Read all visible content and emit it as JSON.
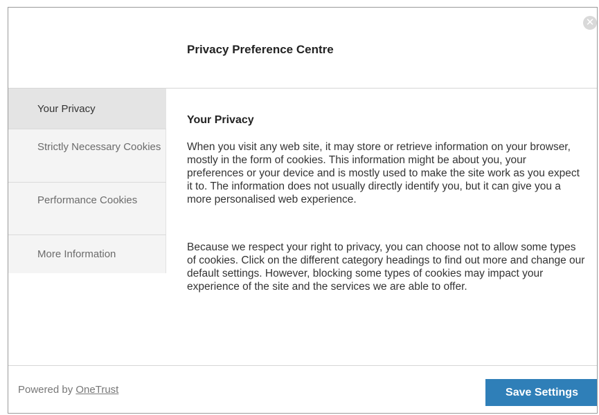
{
  "dialog": {
    "title": "Privacy Preference Centre",
    "close_icon": "close-icon"
  },
  "sidebar": {
    "items": [
      {
        "label": "Your Privacy",
        "active": true
      },
      {
        "label": "Strictly Necessary Cookies",
        "active": false
      },
      {
        "label": "Performance Cookies",
        "active": false
      },
      {
        "label": "More Information",
        "active": false
      }
    ]
  },
  "content": {
    "title": "Your Privacy",
    "paragraphs": [
      "When you visit any web site, it may store or retrieve information on your browser, mostly in the form of cookies. This information might be about you, your preferences or your device and is mostly used to make the site work as you expect it to. The information does not usually directly identify you, but it can give you a more personalised web experience.",
      "Because we respect your right to privacy, you can choose not to allow some types of cookies. Click on the different category headings to find out more and change our default settings. However, blocking some types of cookies may impact your experience of the site and the services we are able to offer."
    ]
  },
  "footer": {
    "powered_prefix": "Powered by ",
    "powered_link": "OneTrust",
    "save_label": "Save Settings"
  },
  "colors": {
    "accent": "#2f7fb8",
    "sidebar_bg": "#f4f4f4",
    "active_item_bg": "#e4e4e4"
  }
}
